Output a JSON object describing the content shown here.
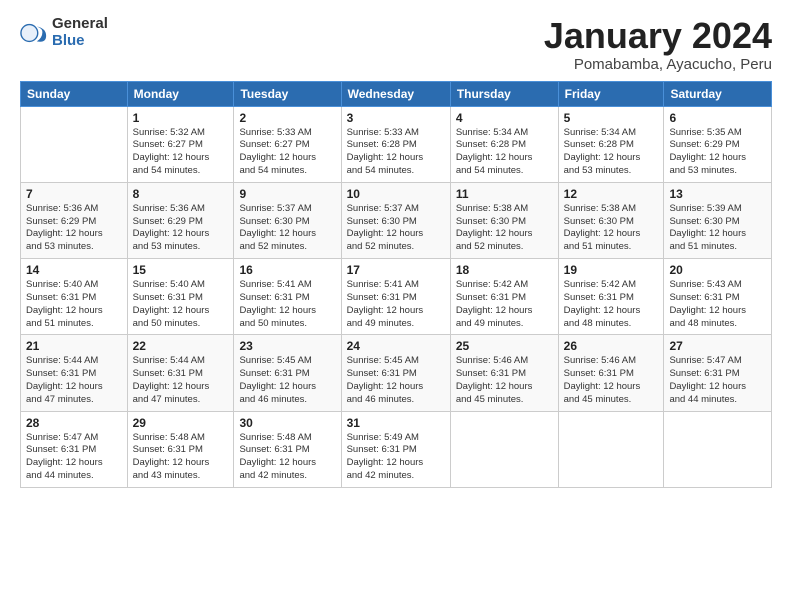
{
  "logo": {
    "general": "General",
    "blue": "Blue"
  },
  "title": {
    "month": "January 2024",
    "location": "Pomabamba, Ayacucho, Peru"
  },
  "headers": [
    "Sunday",
    "Monday",
    "Tuesday",
    "Wednesday",
    "Thursday",
    "Friday",
    "Saturday"
  ],
  "weeks": [
    [
      {
        "day": "",
        "info": ""
      },
      {
        "day": "1",
        "info": "Sunrise: 5:32 AM\nSunset: 6:27 PM\nDaylight: 12 hours\nand 54 minutes."
      },
      {
        "day": "2",
        "info": "Sunrise: 5:33 AM\nSunset: 6:27 PM\nDaylight: 12 hours\nand 54 minutes."
      },
      {
        "day": "3",
        "info": "Sunrise: 5:33 AM\nSunset: 6:28 PM\nDaylight: 12 hours\nand 54 minutes."
      },
      {
        "day": "4",
        "info": "Sunrise: 5:34 AM\nSunset: 6:28 PM\nDaylight: 12 hours\nand 54 minutes."
      },
      {
        "day": "5",
        "info": "Sunrise: 5:34 AM\nSunset: 6:28 PM\nDaylight: 12 hours\nand 53 minutes."
      },
      {
        "day": "6",
        "info": "Sunrise: 5:35 AM\nSunset: 6:29 PM\nDaylight: 12 hours\nand 53 minutes."
      }
    ],
    [
      {
        "day": "7",
        "info": "Sunrise: 5:36 AM\nSunset: 6:29 PM\nDaylight: 12 hours\nand 53 minutes."
      },
      {
        "day": "8",
        "info": "Sunrise: 5:36 AM\nSunset: 6:29 PM\nDaylight: 12 hours\nand 53 minutes."
      },
      {
        "day": "9",
        "info": "Sunrise: 5:37 AM\nSunset: 6:30 PM\nDaylight: 12 hours\nand 52 minutes."
      },
      {
        "day": "10",
        "info": "Sunrise: 5:37 AM\nSunset: 6:30 PM\nDaylight: 12 hours\nand 52 minutes."
      },
      {
        "day": "11",
        "info": "Sunrise: 5:38 AM\nSunset: 6:30 PM\nDaylight: 12 hours\nand 52 minutes."
      },
      {
        "day": "12",
        "info": "Sunrise: 5:38 AM\nSunset: 6:30 PM\nDaylight: 12 hours\nand 51 minutes."
      },
      {
        "day": "13",
        "info": "Sunrise: 5:39 AM\nSunset: 6:30 PM\nDaylight: 12 hours\nand 51 minutes."
      }
    ],
    [
      {
        "day": "14",
        "info": "Sunrise: 5:40 AM\nSunset: 6:31 PM\nDaylight: 12 hours\nand 51 minutes."
      },
      {
        "day": "15",
        "info": "Sunrise: 5:40 AM\nSunset: 6:31 PM\nDaylight: 12 hours\nand 50 minutes."
      },
      {
        "day": "16",
        "info": "Sunrise: 5:41 AM\nSunset: 6:31 PM\nDaylight: 12 hours\nand 50 minutes."
      },
      {
        "day": "17",
        "info": "Sunrise: 5:41 AM\nSunset: 6:31 PM\nDaylight: 12 hours\nand 49 minutes."
      },
      {
        "day": "18",
        "info": "Sunrise: 5:42 AM\nSunset: 6:31 PM\nDaylight: 12 hours\nand 49 minutes."
      },
      {
        "day": "19",
        "info": "Sunrise: 5:42 AM\nSunset: 6:31 PM\nDaylight: 12 hours\nand 48 minutes."
      },
      {
        "day": "20",
        "info": "Sunrise: 5:43 AM\nSunset: 6:31 PM\nDaylight: 12 hours\nand 48 minutes."
      }
    ],
    [
      {
        "day": "21",
        "info": "Sunrise: 5:44 AM\nSunset: 6:31 PM\nDaylight: 12 hours\nand 47 minutes."
      },
      {
        "day": "22",
        "info": "Sunrise: 5:44 AM\nSunset: 6:31 PM\nDaylight: 12 hours\nand 47 minutes."
      },
      {
        "day": "23",
        "info": "Sunrise: 5:45 AM\nSunset: 6:31 PM\nDaylight: 12 hours\nand 46 minutes."
      },
      {
        "day": "24",
        "info": "Sunrise: 5:45 AM\nSunset: 6:31 PM\nDaylight: 12 hours\nand 46 minutes."
      },
      {
        "day": "25",
        "info": "Sunrise: 5:46 AM\nSunset: 6:31 PM\nDaylight: 12 hours\nand 45 minutes."
      },
      {
        "day": "26",
        "info": "Sunrise: 5:46 AM\nSunset: 6:31 PM\nDaylight: 12 hours\nand 45 minutes."
      },
      {
        "day": "27",
        "info": "Sunrise: 5:47 AM\nSunset: 6:31 PM\nDaylight: 12 hours\nand 44 minutes."
      }
    ],
    [
      {
        "day": "28",
        "info": "Sunrise: 5:47 AM\nSunset: 6:31 PM\nDaylight: 12 hours\nand 44 minutes."
      },
      {
        "day": "29",
        "info": "Sunrise: 5:48 AM\nSunset: 6:31 PM\nDaylight: 12 hours\nand 43 minutes."
      },
      {
        "day": "30",
        "info": "Sunrise: 5:48 AM\nSunset: 6:31 PM\nDaylight: 12 hours\nand 42 minutes."
      },
      {
        "day": "31",
        "info": "Sunrise: 5:49 AM\nSunset: 6:31 PM\nDaylight: 12 hours\nand 42 minutes."
      },
      {
        "day": "",
        "info": ""
      },
      {
        "day": "",
        "info": ""
      },
      {
        "day": "",
        "info": ""
      }
    ]
  ]
}
